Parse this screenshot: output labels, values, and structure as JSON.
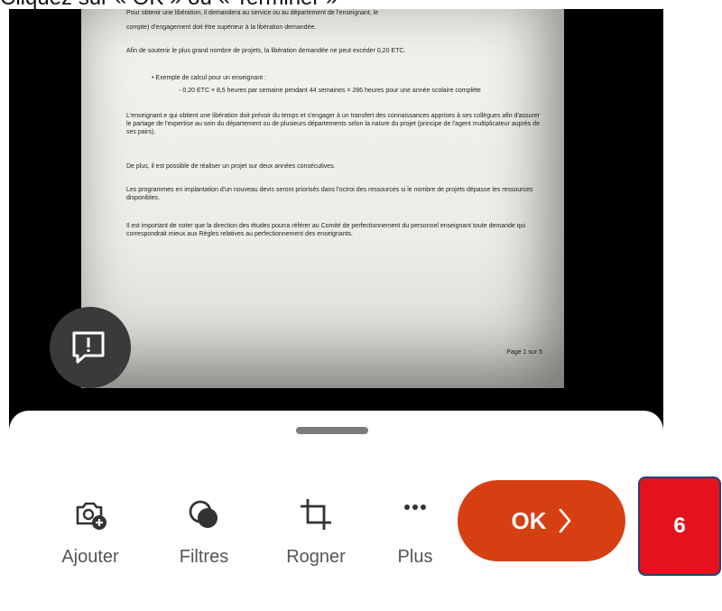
{
  "caption": "Cliquez sur « OK » ou « Terminer »",
  "document": {
    "lines": [
      {
        "text": "Pour obtenir une libération, il demandera au service ou au département de l'enseignant, le",
        "cls": "wrap"
      },
      {
        "text": "compte) d'engagement doit être supérieur à la libération demandée.",
        "cls": ""
      },
      {
        "text": "Afin de soutenir le plus grand nombre de projets, la libération demandée ne peut excéder 0,20 ETC.",
        "cls": ""
      },
      {
        "text": "•  Exemple de calcul pour un enseignant :",
        "cls": "bullet1"
      },
      {
        "text": "◦  0,20 ETC × 8,5 heures par semaine pendant 44 semaines = 286 heures pour une année scolaire complète",
        "cls": "bullet2"
      },
      {
        "text": "L'enseignant.e qui obtient une libération doit prévoir du temps et s'engager à un transfert des connaissances apprises à ses collègues afin d'assurer le partage de l'expertise au sein du département ou de plusieurs départements selon la nature du projet (principe de l'agent multiplicateur auprès de ses pairs).",
        "cls": "wrap"
      },
      {
        "text": "De plus, il est possible de réaliser un projet sur deux années consécutives.",
        "cls": ""
      },
      {
        "text": "Les programmes en implantation d'un nouveau devis seront priorisés dans l'octroi des ressources si le nombre de projets dépasse les ressources disponibles.",
        "cls": "wrap"
      },
      {
        "text": "Il est important de noter que la direction des études pourra référer au Comité de perfectionnement du personnel enseignant toute demande qui correspondrait mieux aux Règles relatives au perfectionnement des enseignants.",
        "cls": "wrap"
      }
    ],
    "page_number": "Page 1 sur 5"
  },
  "toolbar": {
    "items": [
      {
        "label": "Ajouter",
        "icon": "camera-plus-icon"
      },
      {
        "label": "Filtres",
        "icon": "filters-icon"
      },
      {
        "label": "Rogner",
        "icon": "crop-icon"
      },
      {
        "label": "Plus",
        "icon": "more-icon"
      }
    ],
    "ok_label": "OK",
    "ok_color": "#d63f11"
  },
  "badge": {
    "text": "6",
    "color": "#e4121c"
  }
}
